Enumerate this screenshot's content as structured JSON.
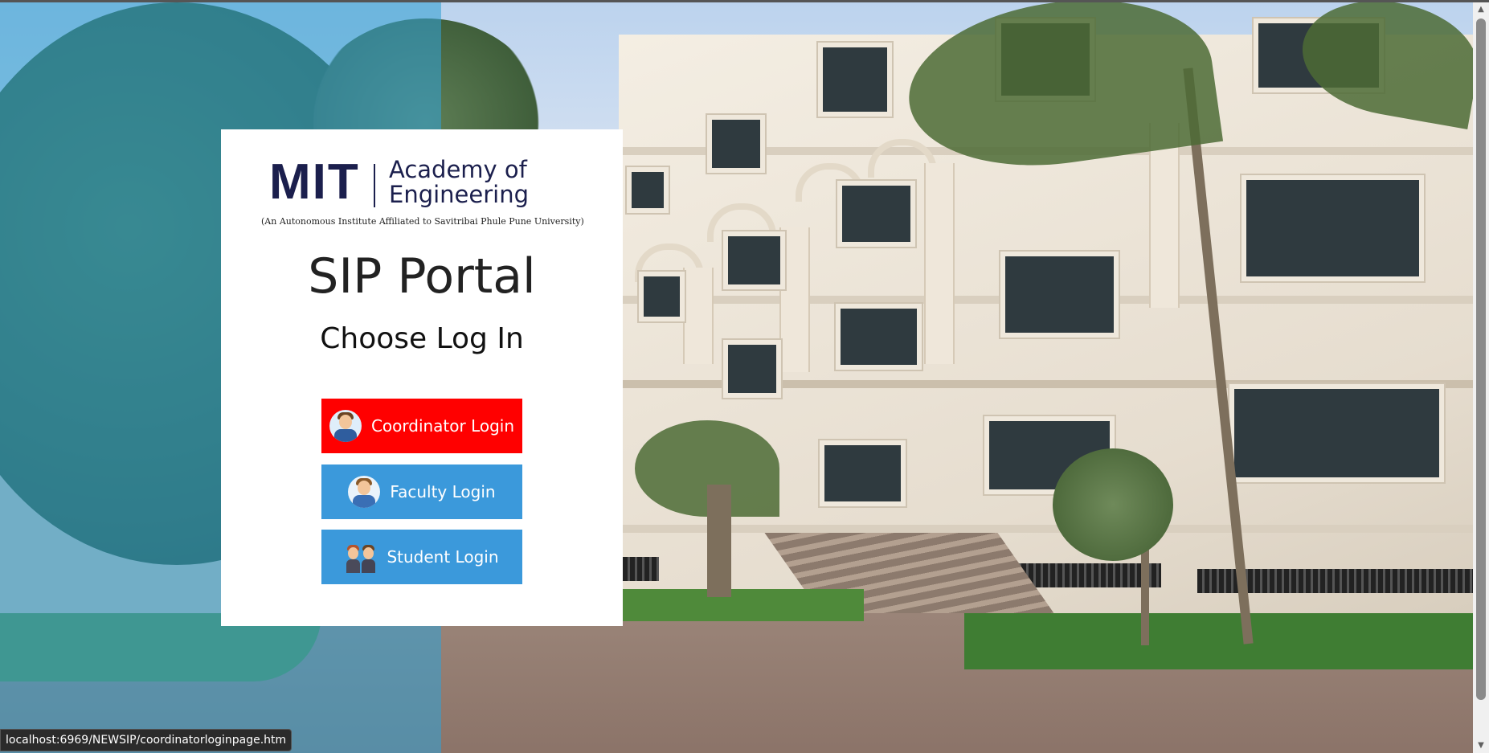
{
  "logo": {
    "brand": "MIT",
    "name_line1": "Academy of",
    "name_line2": "Engineering",
    "tagline": "(An Autonomous Institute Affiliated to Savitribai Phule Pune University)"
  },
  "page": {
    "title": "SIP Portal",
    "subtitle": "Choose Log In"
  },
  "buttons": {
    "coordinator": {
      "label": "Coordinator Login",
      "icon": "coordinator-avatar-icon",
      "color": "#ff0000"
    },
    "faculty": {
      "label": "Faculty Login",
      "icon": "faculty-avatar-icon",
      "color": "#3b99db"
    },
    "student": {
      "label": "Student Login",
      "icon": "students-avatar-icon",
      "color": "#3b99db"
    }
  },
  "statusbar": {
    "url": "localhost:6969/NEWSIP/coordinatorloginpage.htm"
  },
  "scrollbar": {
    "up_icon": "▲",
    "down_icon": "▼"
  },
  "colors": {
    "overlay": "#34a0d2",
    "brand_navy": "#1b1f4d"
  }
}
